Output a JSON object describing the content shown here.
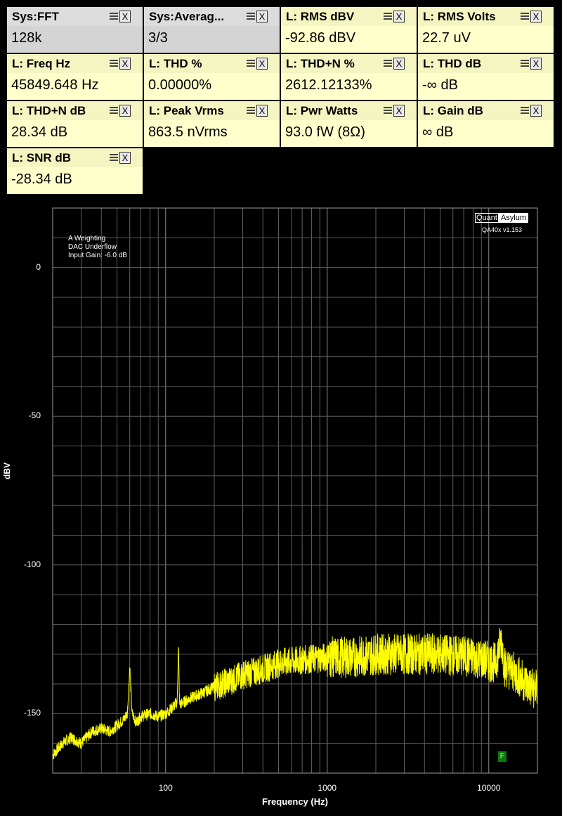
{
  "tiles": [
    {
      "title": "Sys:FFT",
      "value": "128k",
      "kind": "sys"
    },
    {
      "title": "Sys:Averag...",
      "value": "3/3",
      "kind": "sys"
    },
    {
      "title": "L: RMS dBV",
      "value": "-92.86 dBV",
      "kind": "lch"
    },
    {
      "title": "L: RMS Volts",
      "value": "22.7 uV",
      "kind": "lch"
    },
    {
      "title": "L: Freq Hz",
      "value": "45849.648 Hz",
      "kind": "lch"
    },
    {
      "title": "L: THD %",
      "value": "0.00000%",
      "kind": "lch"
    },
    {
      "title": "L: THD+N %",
      "value": "2612.12133%",
      "kind": "lch"
    },
    {
      "title": "L: THD dB",
      "value": "-∞ dB",
      "kind": "lch"
    },
    {
      "title": "L: THD+N dB",
      "value": "28.34 dB",
      "kind": "lch"
    },
    {
      "title": "L: Peak Vrms",
      "value": "863.5 nVrms",
      "kind": "lch"
    },
    {
      "title": "L: Pwr Watts",
      "value": "93.0 fW (8Ω)",
      "kind": "lch"
    },
    {
      "title": "L: Gain dB",
      "value": "∞ dB",
      "kind": "lch"
    },
    {
      "title": "L: SNR dB",
      "value": "-28.34 dB",
      "kind": "lch"
    }
  ],
  "tile_close_label": "X",
  "graph": {
    "notes": [
      "A Weighting",
      "DAC Underflow",
      "Input Gain: -6.0 dB"
    ],
    "brand_left": "Quant",
    "brand_right": "Asylum",
    "version": "QA40x v1.153",
    "badge": "F"
  },
  "chart_data": {
    "type": "line",
    "xlabel": "Frequency (Hz)",
    "ylabel": "dBV",
    "xscale": "log",
    "xlim": [
      20,
      20000
    ],
    "ylim": [
      -170,
      20
    ],
    "xticks": [
      100,
      1000,
      10000
    ],
    "xtick_labels": [
      "100",
      "1000",
      "10000"
    ],
    "yticks": [
      0,
      -50,
      -100,
      -150
    ],
    "ytick_labels": [
      "0",
      "-50",
      "-100",
      "-150"
    ],
    "grid": true,
    "series": [
      {
        "color": "#ffff00",
        "points": [
          [
            20,
            -164
          ],
          [
            23,
            -160
          ],
          [
            26,
            -158
          ],
          [
            30,
            -160
          ],
          [
            35,
            -156
          ],
          [
            40,
            -155
          ],
          [
            45,
            -156
          ],
          [
            50,
            -154
          ],
          [
            55,
            -152
          ],
          [
            58,
            -150
          ],
          [
            60,
            -134
          ],
          [
            62,
            -150
          ],
          [
            66,
            -153
          ],
          [
            70,
            -151
          ],
          [
            80,
            -150
          ],
          [
            90,
            -151
          ],
          [
            100,
            -150
          ],
          [
            110,
            -148
          ],
          [
            118,
            -146
          ],
          [
            120,
            -127
          ],
          [
            122,
            -147
          ],
          [
            140,
            -145
          ],
          [
            170,
            -143
          ],
          [
            200,
            -141
          ],
          [
            250,
            -139
          ],
          [
            300,
            -137
          ],
          [
            400,
            -135
          ],
          [
            500,
            -133
          ],
          [
            700,
            -132
          ],
          [
            1000,
            -131
          ],
          [
            1500,
            -131
          ],
          [
            2000,
            -130
          ],
          [
            3000,
            -130
          ],
          [
            5000,
            -130
          ],
          [
            8000,
            -131
          ],
          [
            11000,
            -133
          ],
          [
            12000,
            -125
          ],
          [
            12500,
            -134
          ],
          [
            15000,
            -137
          ],
          [
            18000,
            -141
          ],
          [
            20000,
            -142
          ]
        ]
      }
    ]
  }
}
